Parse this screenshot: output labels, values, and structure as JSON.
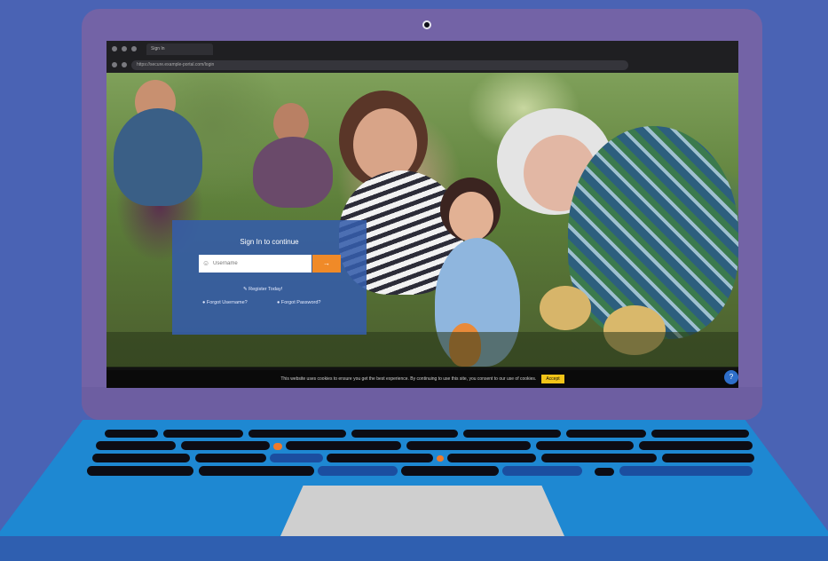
{
  "browser": {
    "tab_title": "Sign In",
    "address": "https://secure.example-portal.com/login"
  },
  "signin": {
    "title": "Sign In to continue",
    "username_placeholder": "Username",
    "go_label": "→",
    "register_label": "Register Today!",
    "forgot_username_label": "Forgot Username?",
    "forgot_password_label": "Forgot Password?"
  },
  "cookie": {
    "text": "This website uses cookies to ensure you get the best experience. By continuing to use this site, you consent to our use of cookies.",
    "accept_label": "Accept"
  },
  "help": {
    "icon": "chat-icon",
    "glyph": "?"
  },
  "colors": {
    "background": "#4a63b4",
    "lid": "#7363a6",
    "base": "#1e88d2",
    "signin_panel": "#345caa",
    "go_button": "#f08a28",
    "cookie_accept": "#f2c418"
  }
}
